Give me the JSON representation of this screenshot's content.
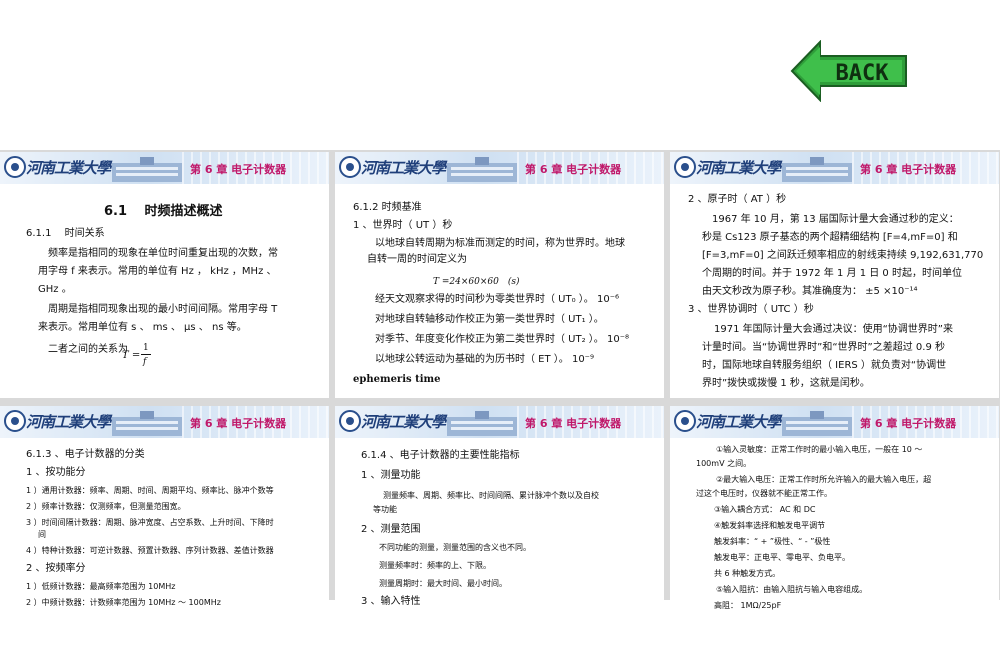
{
  "header_chapter": "第 6 章 电子计数器",
  "logo_text": "河南工業大學",
  "back_label": "BACK",
  "slide1": {
    "title": "6.1　 时频描述概述",
    "sub": "6.1.1　 时间关系",
    "p1a": "频率是指相同的现象在单位时间重复出现的次数，常",
    "p1b": "用字母 f 来表示。常用的单位有 Hz ， kHz ，MHz 、",
    "p1c": "GHz 。",
    "p2a": "周期是指相同现象出现的最小时间间隔。常用字母 T",
    "p2b": "来表示。常用单位有 s 、 ms 、 μs 、 ns 等。",
    "p3": "二者之间的关系为",
    "formula_T": "T =",
    "formula_num": "1",
    "formula_den": "f"
  },
  "slide2": {
    "l1": "6.1.2  时频基准",
    "l2": "1 、世界时（ UT ）秒",
    "l3": "以地球自转周期为标准而测定的时间，称为世界时。地球",
    "l4": "自转一周的时间定义为",
    "l5": "T =24×60×60　(s)",
    "l6": "经天文观察求得的时间秒为零类世界时（ UT₀ ）。 10⁻⁶",
    "l7": "对地球自转轴移动作校正为第一类世界时（ UT₁ ）。",
    "l8": "对季节、年度变化作校正为第二类世界时（ UT₂ ）。 10⁻⁸",
    "l9": "以地球公转运动为基础的为历书时（ ET ）。 10⁻⁹",
    "l10": "ephemeris time"
  },
  "slide3": {
    "l1": "2 、原子时（ AT ）秒",
    "l2": "1967 年 10 月，第 13 届国际计量大会通过秒的定义：",
    "l3": "秒是 Cs123 原子基态的两个超精细结构 [F=4,mF=0] 和",
    "l4": "[F=3,mF=0] 之间跃迁频率相应的射线束持续 9,192,631,770",
    "l5": "个周期的时间。并于 1972 年 1 月 1 日 0 时起，时间单位",
    "l6": "由天文秒改为原子秒。其准确度为：  ±5 ×10⁻¹⁴",
    "l7": "3 、世界协调时（ UTC ）秒",
    "l8": "1971 年国际计量大会通过决议：使用“协调世界时”来",
    "l9": "计量时间。当“协调世界时”和“世界时”之差超过 0.9 秒",
    "l10": "时，国际地球自转服务组织（ IERS ）就负责对“协调世",
    "l11": "界时”拨快或拨慢 1 秒，这就是闰秒。"
  },
  "slide4": {
    "l1": "6.1.3 、电子计数器的分类",
    "l2": "1 、按功能分",
    "l3": "1 ）通用计数器：频率、周期、时间、周期平均、频率比、脉冲个数等",
    "l4": "2 ）频率计数器：仅测频率，但测量范围宽。",
    "l5": "3 ）时间间隔计数器：周期、脉冲宽度、占空系数、上升时间、下降时",
    "l5b": "间",
    "l6": "4 ）特种计数器：可逆计数器、预置计数器、序列计数器、差值计数器",
    "l7": "2 、按频率分",
    "l8": "1 ）低频计数器：最高频率范围为 10MHz",
    "l9": "2 ）中频计数器：计数频率范围为 10MHz ～ 100MHz"
  },
  "slide5": {
    "l1": "6.1.4 、电子计数器的主要性能指标",
    "l2": "1 、测量功能",
    "l3": "测量频率、周期、频率比、时间间隔、累计脉冲个数以及自校",
    "l3b": "等功能",
    "l4": "2 、测量范围",
    "l5": "不同功能的测量，测量范围的含义也不同。",
    "l6": "测量频率时：频率的上、下限。",
    "l7": "测量周期时：最大时间、最小时间。",
    "l8": "3 、输入特性"
  },
  "slide6": {
    "l1": "①输入灵敏度：正常工作时的最小输入电压，一般在 10 ～",
    "l1b": "100mV 之间。",
    "l2": "②最大输入电压：正常工作时所允许输入的最大输入电压，超",
    "l2b": "过这个电压时，仪器就不能正常工作。",
    "l3": "③输入耦合方式： AC 和 DC",
    "l4": "④触发斜率选择和触发电平调节",
    "l5": "触发斜率：“ + ”极性、“ - ”极性",
    "l6": "触发电平：正电平、零电平、负电平。",
    "l7": "共 6 种触发方式。",
    "l8": "⑤输入阻抗：由输入阻抗与输入电容组成。",
    "l9": "高阻： 1MΩ/25pF"
  },
  "colors": {
    "chapter": "#c0186a",
    "back_green": "#2f9e3a"
  }
}
